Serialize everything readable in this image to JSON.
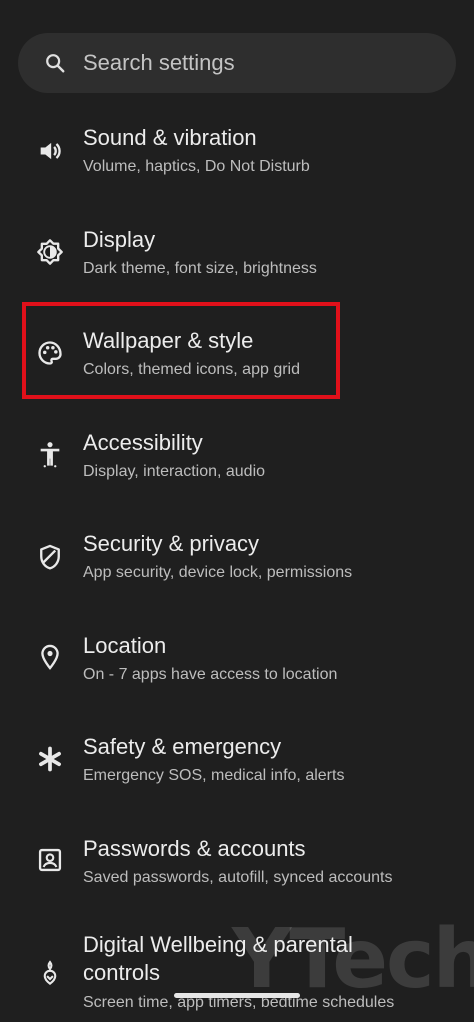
{
  "search": {
    "placeholder": "Search settings",
    "icon": "search-icon"
  },
  "settings": [
    {
      "title": "Sound & vibration",
      "subtitle": "Volume, haptics, Do Not Disturb",
      "icon": "speaker-icon"
    },
    {
      "title": "Display",
      "subtitle": "Dark theme, font size, brightness",
      "icon": "brightness-icon"
    },
    {
      "title": "Wallpaper & style",
      "subtitle": "Colors, themed icons, app grid",
      "icon": "palette-icon",
      "highlighted": true
    },
    {
      "title": "Accessibility",
      "subtitle": "Display, interaction, audio",
      "icon": "accessibility-icon"
    },
    {
      "title": "Security & privacy",
      "subtitle": "App security, device lock, permissions",
      "icon": "shield-icon"
    },
    {
      "title": "Location",
      "subtitle": "On - 7 apps have access to location",
      "icon": "location-pin-icon"
    },
    {
      "title": "Safety & emergency",
      "subtitle": "Emergency SOS, medical info, alerts",
      "icon": "asterisk-icon"
    },
    {
      "title": "Passwords & accounts",
      "subtitle": "Saved passwords, autofill, synced accounts",
      "icon": "account-box-icon"
    },
    {
      "title": "Digital Wellbeing & parental controls",
      "subtitle": "Screen time, app timers, bedtime schedules",
      "icon": "wellbeing-icon"
    }
  ],
  "watermark": "YTechB",
  "colors": {
    "background": "#1f1f1f",
    "highlight": "#e0101a"
  }
}
